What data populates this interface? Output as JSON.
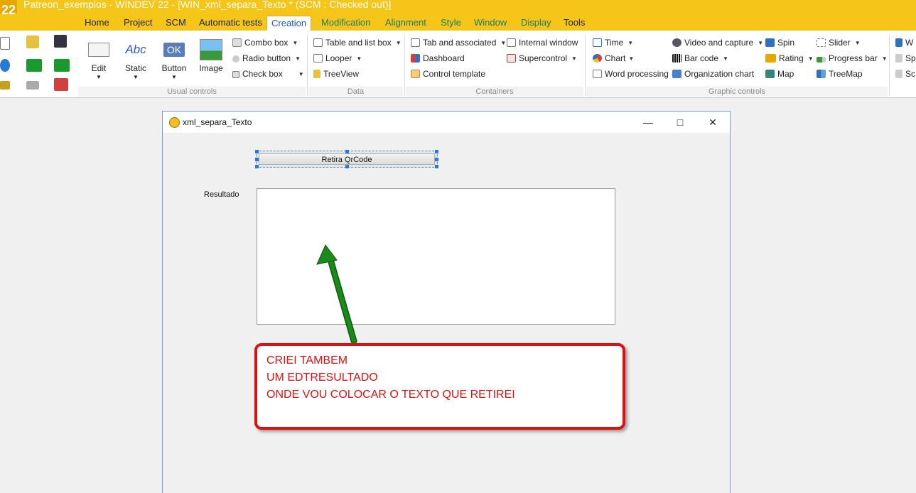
{
  "titlebar": {
    "logo": "22",
    "title": "Patreon_exemplos - WINDEV 22 - [WIN_xml_separa_Texto * (SCM : Checked out)]"
  },
  "menu": {
    "tabs": [
      {
        "label": "Home"
      },
      {
        "label": "Project"
      },
      {
        "label": "SCM"
      },
      {
        "label": "Automatic tests"
      },
      {
        "label": "Creation"
      },
      {
        "label": "Modification"
      },
      {
        "label": "Alignment"
      },
      {
        "label": "Style"
      },
      {
        "label": "Window"
      },
      {
        "label": "Display"
      },
      {
        "label": "Tools"
      }
    ],
    "active": "Creation"
  },
  "ribbon": {
    "usual": {
      "label": "Usual controls",
      "edit": "Edit",
      "static": "Static",
      "static_icon_text": "Abc",
      "button": "Button",
      "button_icon_text": "OK",
      "image": "Image",
      "combo": "Combo box",
      "radio": "Radio button",
      "check": "Check box"
    },
    "data": {
      "label": "Data",
      "table": "Table and list box",
      "looper": "Looper",
      "treeview": "TreeView"
    },
    "containers": {
      "label": "Containers",
      "tab": "Tab and associated",
      "dashboard": "Dashboard",
      "control_template": "Control template",
      "internal": "Internal window",
      "supercontrol": "Supercontrol"
    },
    "graphic": {
      "label": "Graphic controls",
      "time": "Time",
      "chart": "Chart",
      "word": "Word processing",
      "video": "Video and capture",
      "barcode": "Bar code",
      "org": "Organization chart",
      "spin": "Spin",
      "rating": "Rating",
      "map": "Map",
      "slider": "Slider",
      "progress": "Progress bar",
      "treemap": "TreeMap"
    },
    "more": {
      "w": "W",
      "sp": "Sp",
      "sc": "Sc"
    }
  },
  "window": {
    "title": "xml_separa_Texto",
    "button_label": "Retira QrCode",
    "result_label": "Resultado",
    "result_value": ""
  },
  "annotation": {
    "lines": [
      "CRIEI TAMBEM",
      "UM EDTRESULTADO",
      "ONDE VOU COLOCAR O TEXTO QUE RETIREI"
    ],
    "color": "#e01010",
    "arrow_color": "#1a8a1a"
  }
}
